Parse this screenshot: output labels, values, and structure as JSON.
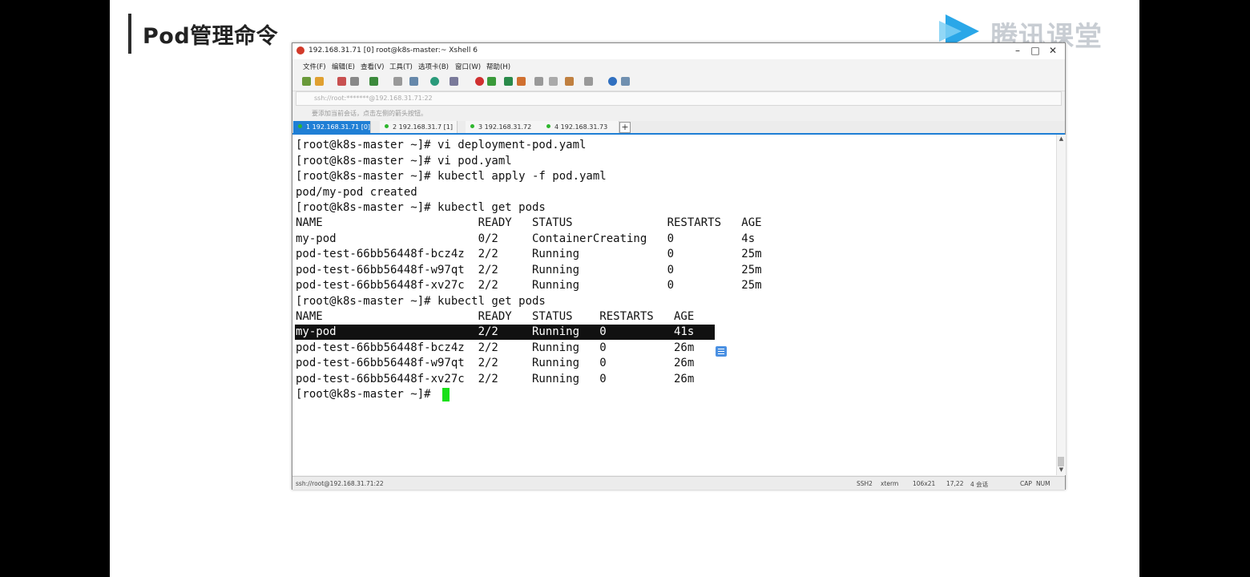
{
  "slide": {
    "title": "Pod管理命令",
    "logo_text": "腾讯课堂"
  },
  "window": {
    "title": "192.168.31.71 [0]    root@k8s-master:~    Xshell 6",
    "menu": [
      "文件(F)",
      "编辑(E)",
      "查看(V)",
      "工具(T)",
      "选项卡(B)",
      "窗口(W)",
      "帮助(H)"
    ],
    "address": "ssh://root:*******@192.168.31.71:22",
    "hint": "要添加当前会话，点击左侧的箭头按钮。",
    "tabs": [
      {
        "label": "1 192.168.31.71 [0]",
        "active": true
      },
      {
        "label": "2 192.168.31.7 [1]",
        "active": false
      },
      {
        "label": "3 192.168.31.72",
        "active": false
      },
      {
        "label": "4 192.168.31.73",
        "active": false
      }
    ],
    "tab_add": "+"
  },
  "terminal": {
    "lines": [
      "[root@k8s-master ~]# vi deployment-pod.yaml",
      "[root@k8s-master ~]# vi pod.yaml",
      "[root@k8s-master ~]# kubectl apply -f pod.yaml",
      "pod/my-pod created",
      "[root@k8s-master ~]# kubectl get pods",
      "NAME                       READY   STATUS              RESTARTS   AGE",
      "my-pod                     0/2     ContainerCreating   0          4s",
      "pod-test-66bb56448f-bcz4z  2/2     Running             0          25m",
      "pod-test-66bb56448f-w97qt  2/2     Running             0          25m",
      "pod-test-66bb56448f-xv27c  2/2     Running             0          25m",
      "[root@k8s-master ~]# kubectl get pods",
      "NAME                       READY   STATUS    RESTARTS   AGE",
      "my-pod                     2/2     Running   0          41s",
      "pod-test-66bb56448f-bcz4z  2/2     Running   0          26m",
      "pod-test-66bb56448f-w97qt  2/2     Running   0          26m",
      "pod-test-66bb56448f-xv27c  2/2     Running   0          26m",
      "[root@k8s-master ~]# "
    ]
  },
  "statusbar": {
    "left": "ssh://root@192.168.31.71:22",
    "items": [
      "SSH2",
      "xterm",
      "106x21",
      "17,22",
      "4 会话",
      "CAP",
      "NUM"
    ]
  }
}
